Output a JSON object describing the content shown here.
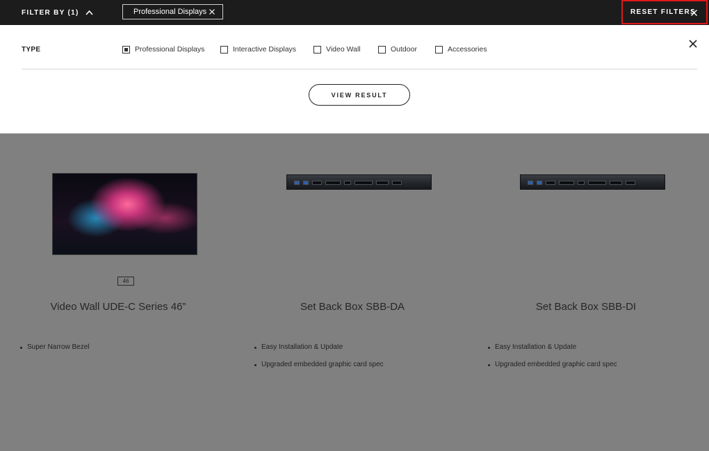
{
  "topbar": {
    "filter_by_label": "FILTER BY (1)",
    "active_chip_label": "Professional Displays",
    "reset_label": "RESET FILTERS"
  },
  "panel": {
    "type_label": "TYPE",
    "options": [
      {
        "label": "Professional Displays",
        "checked": true
      },
      {
        "label": "Interactive Displays",
        "checked": false
      },
      {
        "label": "Video Wall",
        "checked": false
      },
      {
        "label": "Outdoor",
        "checked": false
      },
      {
        "label": "Accessories",
        "checked": false
      }
    ],
    "view_result_label": "VIEW RESULT"
  },
  "products": [
    {
      "title": "Video Wall UDE-C Series 46”",
      "size_badge": "46",
      "features": [
        "Super Narrow Bezel"
      ]
    },
    {
      "title": "Set Back Box SBB-DA",
      "features": [
        "Easy Installation & Update",
        "Upgraded embedded graphic card spec"
      ]
    },
    {
      "title": "Set Back Box SBB-DI",
      "features": [
        "Easy Installation & Update",
        "Upgraded embedded graphic card spec"
      ]
    }
  ],
  "colors": {
    "topbar_bg": "#1c1c1c",
    "highlight_border": "#e01818",
    "overlay_gray": "#808080"
  },
  "icons": {
    "filter_toggle": "chevron-up-icon",
    "chip_remove": "close-icon",
    "reset": "close-icon",
    "panel_close": "close-icon"
  }
}
